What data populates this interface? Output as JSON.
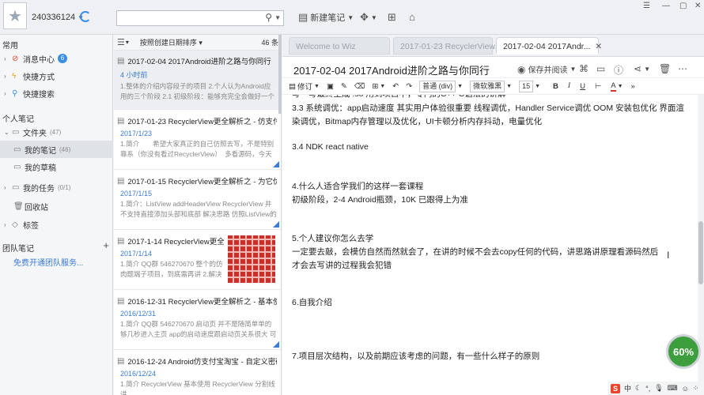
{
  "topbar": {
    "account_id": "240336124",
    "search_placeholder": "",
    "new_note_label": "新建笔记"
  },
  "sidebar": {
    "section_common": "常用",
    "items_common": [
      {
        "label": "消息中心",
        "badge": "6"
      },
      {
        "label": "快捷方式"
      },
      {
        "label": "快捷搜索"
      }
    ],
    "section_personal": "个人笔记",
    "folder": {
      "label": "文件夹",
      "count": "(47)"
    },
    "folder_items": [
      {
        "label": "我的笔记",
        "count": "(46)"
      },
      {
        "label": "我的草稿",
        "count": ""
      },
      {
        "label": "我的任务",
        "count": "(0/1)"
      },
      {
        "label": "回收站",
        "count": ""
      }
    ],
    "tags_label": "标签",
    "section_team": "团队笔记",
    "team_link": "免费开通团队服务..."
  },
  "notelist": {
    "sort_label": "按照创建日期排序",
    "count": "46 条",
    "notes": [
      {
        "title": "2017-02-04 2017Android进阶之路与你同行",
        "date": "4 小时前",
        "snippet": "1.整体的介绍内容段子的项目 2.个人认为Android应用的三个阶段 2.1 初级阶段：能够充完全会做好一个项目..."
      },
      {
        "title": "2017-01-23 RecyclerView更全解析之 - 仿支付宝...",
        "date": "2017/1/23",
        "snippet": "1.简介　　希望大家真正的自己仿照去写，不是特别靠系（你没有看过RecyclerView）　多看源码，今天要..."
      },
      {
        "title": "2017-01-15 RecyclerView更全解析之 - 为它优雅...",
        "date": "2017/1/15",
        "snippet": "1.简介：ListView addHeaderView RecyclerView 并不支持直接添加头部和底部 解决思路 仿照ListView的add..."
      },
      {
        "title": "2017-1-14 RecyclerView更全解...",
        "date": "2017/1/14",
        "snippet": "1.简介 QQ群 546270670 整个的仿肉题端子项目，到底需再讲 2.解决上一..."
      },
      {
        "title": "2016-12-31 RecyclerView更全解析之 - 基本使用...",
        "date": "2016/12/31",
        "snippet": "1.简介 QQ群 546270670 启动页 并不是随简单单的够几秒进入主页 app的启动速度跟启动页关系很大 可以用..."
      },
      {
        "title": "2016-12-24 Android仿支付宝淘宝 - 自定义密码...",
        "date": "2016/12/24",
        "snippet": "1.简介 RecyclerView 基本使用 RecyclerView 分割线讲"
      }
    ]
  },
  "tabs": [
    {
      "label": "Welcome to Wiz"
    },
    {
      "label": "2017-01-23 RecyclerView..."
    },
    {
      "label": "2017-02-04 2017Andr..."
    }
  ],
  "editor": {
    "title": "2017-02-04 2017Android进阶之路与你同行",
    "save_read_label": "保存并阅读",
    "revise_label": "修订",
    "style_select": "普通 (div)",
    "font_select": "微软雅黑",
    "size_select": "15",
    "bold_label": "B",
    "italic_label": "I",
    "underline_label": "U",
    "color_label": "A",
    "paragraphs": [
      "写一写最终生成 .so  用到项目中，专门的C++ C语法的讲解",
      "3.3 系统调优：app启动速度 其实用户体验很重要 线程调优，Handler Service调优  OOM  安装包优化  界面渲染调优，Bitmap内存管理以及优化，UI卡顿分析内存抖动，电量优化",
      "3.4 NDK    react native",
      "4.什么人适合学我们的这样一套课程",
      "初级阶段，2-4 Android瓶颈，10K  已跟得上为准",
      "5.个人建议你怎么去学",
      "一定要去敲，会模仿自然而然就会了，在讲的时候不会去copy任何的代码，讲思路讲原理看源码然后才会去写讲的过程我会犯错",
      "6.自我介绍",
      "7.项目层次结构，以及前期应该考虑的问题，有一些什么样子的原则"
    ]
  },
  "widget": {
    "progress_percent": "60%"
  },
  "ime": {
    "logo": "S",
    "lang": "中"
  }
}
